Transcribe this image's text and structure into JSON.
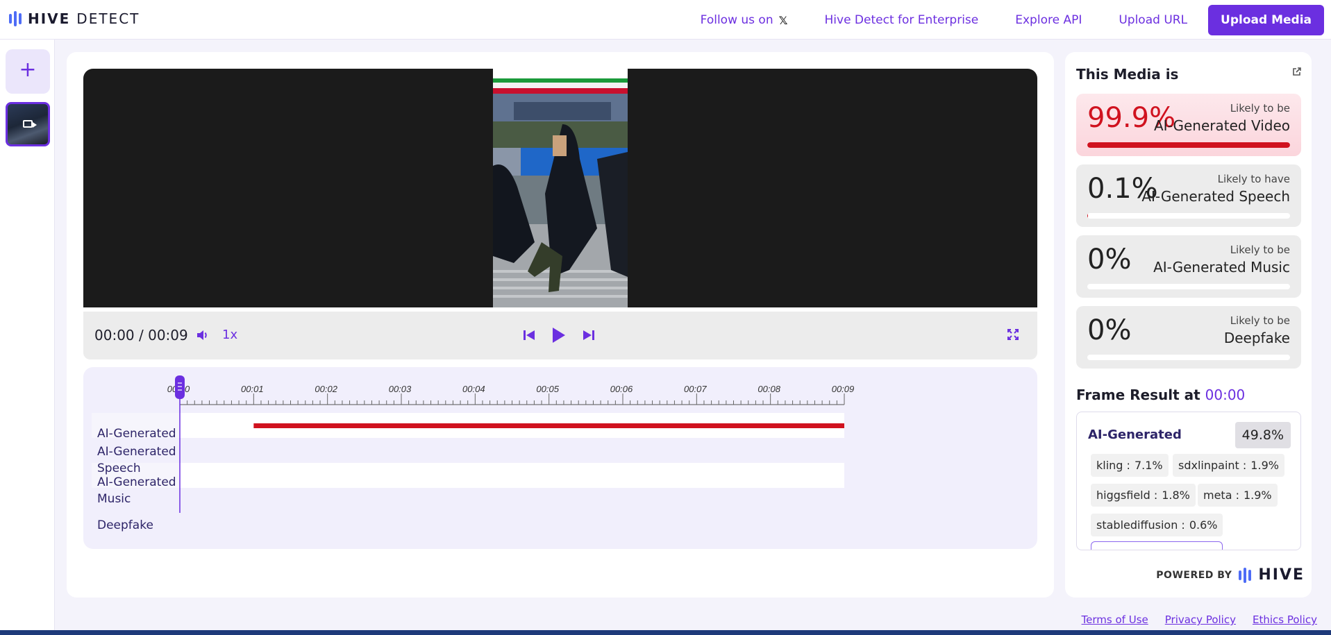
{
  "brand": {
    "name_bold": "HIVE",
    "name_light": "DETECT"
  },
  "nav": {
    "follow": "Follow us on",
    "follow_icon": "x-logo-icon",
    "enterprise": "Hive Detect for Enterprise",
    "api": "Explore API",
    "upload_url": "Upload URL",
    "upload_media": "Upload Media"
  },
  "rail": {
    "add_label": "+"
  },
  "player": {
    "time": "00:00 / 00:09",
    "speed": "1x",
    "position": 0.0,
    "duration_s": 9
  },
  "timeline": {
    "ticks": [
      "00:00",
      "00:01",
      "00:02",
      "00:03",
      "00:04",
      "00:05",
      "00:06",
      "00:07",
      "00:08",
      "00:09"
    ],
    "rows": [
      {
        "label": "AI-Generated",
        "segment_start_s": 1,
        "segment_end_s": 9,
        "color": "#d0121f"
      },
      {
        "label": "AI-Generated Speech"
      },
      {
        "label": "AI-Generated Music"
      },
      {
        "label": "Deepfake"
      }
    ]
  },
  "result": {
    "title": "This Media is",
    "cards": [
      {
        "pct": "99.9%",
        "sub": "Likely to be",
        "label": "AI-Generated Video",
        "fill": 0.999
      },
      {
        "pct": "0.1%",
        "sub": "Likely to have",
        "label": "AI-Generated Speech",
        "fill": 0.001
      },
      {
        "pct": "0%",
        "sub": "Likely to be",
        "label": "AI-Generated Music",
        "fill": 0
      },
      {
        "pct": "0%",
        "sub": "Likely to be",
        "label": "Deepfake",
        "fill": 0
      }
    ]
  },
  "frame": {
    "title": "Frame Result at",
    "time": "00:00",
    "label": "AI-Generated",
    "pct": "49.8%",
    "chips": [
      {
        "name": "kling :",
        "value": "7.1%"
      },
      {
        "name": "sdxlinpaint :",
        "value": "1.9%"
      },
      {
        "name": "higgsfield :",
        "value": "1.8%"
      },
      {
        "name": "meta :",
        "value": "1.9%"
      },
      {
        "name": "stablediffusion :",
        "value": "0.6%"
      }
    ]
  },
  "powered": {
    "by": "POWERED BY",
    "brand": "HIVE"
  },
  "footer": {
    "terms": "Terms of Use",
    "privacy": "Privacy Policy",
    "ethics": "Ethics Policy"
  }
}
